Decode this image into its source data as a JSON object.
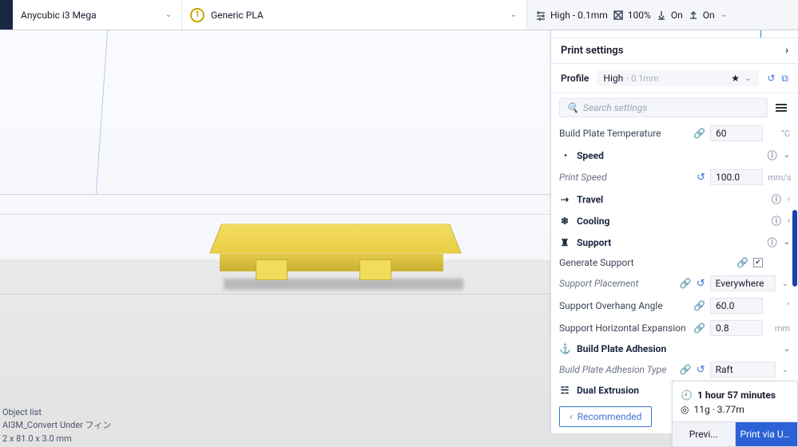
{
  "topbar": {
    "printer": "Anycubic i3 Mega",
    "material_index": "1",
    "material": "Generic PLA",
    "quality_label": "High - 0.1mm",
    "infill_label": "100%",
    "support_toggle": "On",
    "adhesion_toggle": "On"
  },
  "panel": {
    "title": "Print settings",
    "profile_label": "Profile",
    "profile_value": "High",
    "profile_dim": "- 0.1mm",
    "search_placeholder": "Search settings",
    "settings": {
      "build_plate_temp_label": "Build Plate Temperature",
      "build_plate_temp_value": "60",
      "build_plate_temp_unit": "°C",
      "speed_cat": "Speed",
      "print_speed_label": "Print Speed",
      "print_speed_value": "100.0",
      "print_speed_unit": "mm/s",
      "travel_cat": "Travel",
      "cooling_cat": "Cooling",
      "support_cat": "Support",
      "gen_support_label": "Generate Support",
      "support_placement_label": "Support Placement",
      "support_placement_value": "Everywhere",
      "support_angle_label": "Support Overhang Angle",
      "support_angle_value": "60.0",
      "support_angle_unit": "°",
      "support_hexp_label": "Support Horizontal Expansion",
      "support_hexp_value": "0.8",
      "support_hexp_unit": "mm",
      "bpa_cat": "Build Plate Adhesion",
      "bpa_type_label": "Build Plate Adhesion Type",
      "bpa_type_value": "Raft",
      "dual_ext_cat": "Dual Extrusion"
    },
    "recommended_label": "Recommended"
  },
  "object_list": {
    "title": "Object list",
    "name": "AI3M_Convert Under フィン",
    "dims": "2 x 81.0 x 3.0 mm"
  },
  "action": {
    "time": "1 hour 57 minutes",
    "mat": "11g · 3.77m",
    "preview": "Previ...",
    "print": "Print via USB"
  }
}
